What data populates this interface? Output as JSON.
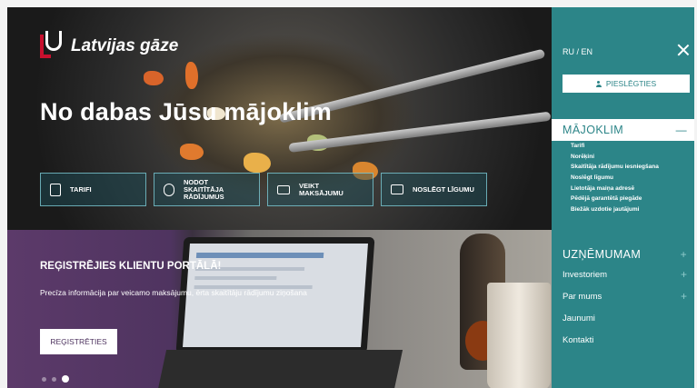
{
  "brand": {
    "name": "Latvijas gāze"
  },
  "hero": {
    "title": "No dabas Jūsu mājoklim",
    "tiles": [
      {
        "label": "TARIFI",
        "icon": "calculator-icon"
      },
      {
        "label": "NODOT SKAITĪTĀJA RĀDĪJUMUS",
        "icon": "meter-icon"
      },
      {
        "label": "VEIKT MAKSĀJUMU",
        "icon": "credit-card-icon"
      },
      {
        "label": "NOSLĒGT LĪGUMU",
        "icon": "contract-icon"
      }
    ]
  },
  "banner": {
    "title": "REĢISTRĒJIES KLIENTU PORTĀLĀ!",
    "subtitle": "Precīza informācija par veicamo maksājumu, ērta skaitītāju rādījumu ziņošana",
    "button": "REĢISTRĒTIES",
    "slides": 3,
    "active_slide": 3
  },
  "menu": {
    "lang": "RU / EN",
    "login": "PIESLĒGTIES",
    "sections": [
      {
        "label": "MĀJOKLIM",
        "toggle": "—",
        "expanded": true
      },
      {
        "label": "UZŅĒMUMAM",
        "toggle": "+",
        "expanded": false
      }
    ],
    "sub_items": [
      "Tarifi",
      "Norēķini",
      "Skaitītāja rādījumu iesniegšana",
      "Noslēgt līgumu",
      "Lietotāja maiņa adresē",
      "Pēdējā garantētā piegāde",
      "Biežāk uzdotie jautājumi"
    ],
    "items": [
      {
        "label": "Investoriem",
        "toggle": "+"
      },
      {
        "label": "Par mums",
        "toggle": "+"
      },
      {
        "label": "Jaunumi",
        "toggle": ""
      },
      {
        "label": "Kontakti",
        "toggle": ""
      }
    ]
  },
  "colors": {
    "teal": "#2c8588",
    "purple": "#4f3460",
    "brand_red": "#c8102e"
  }
}
